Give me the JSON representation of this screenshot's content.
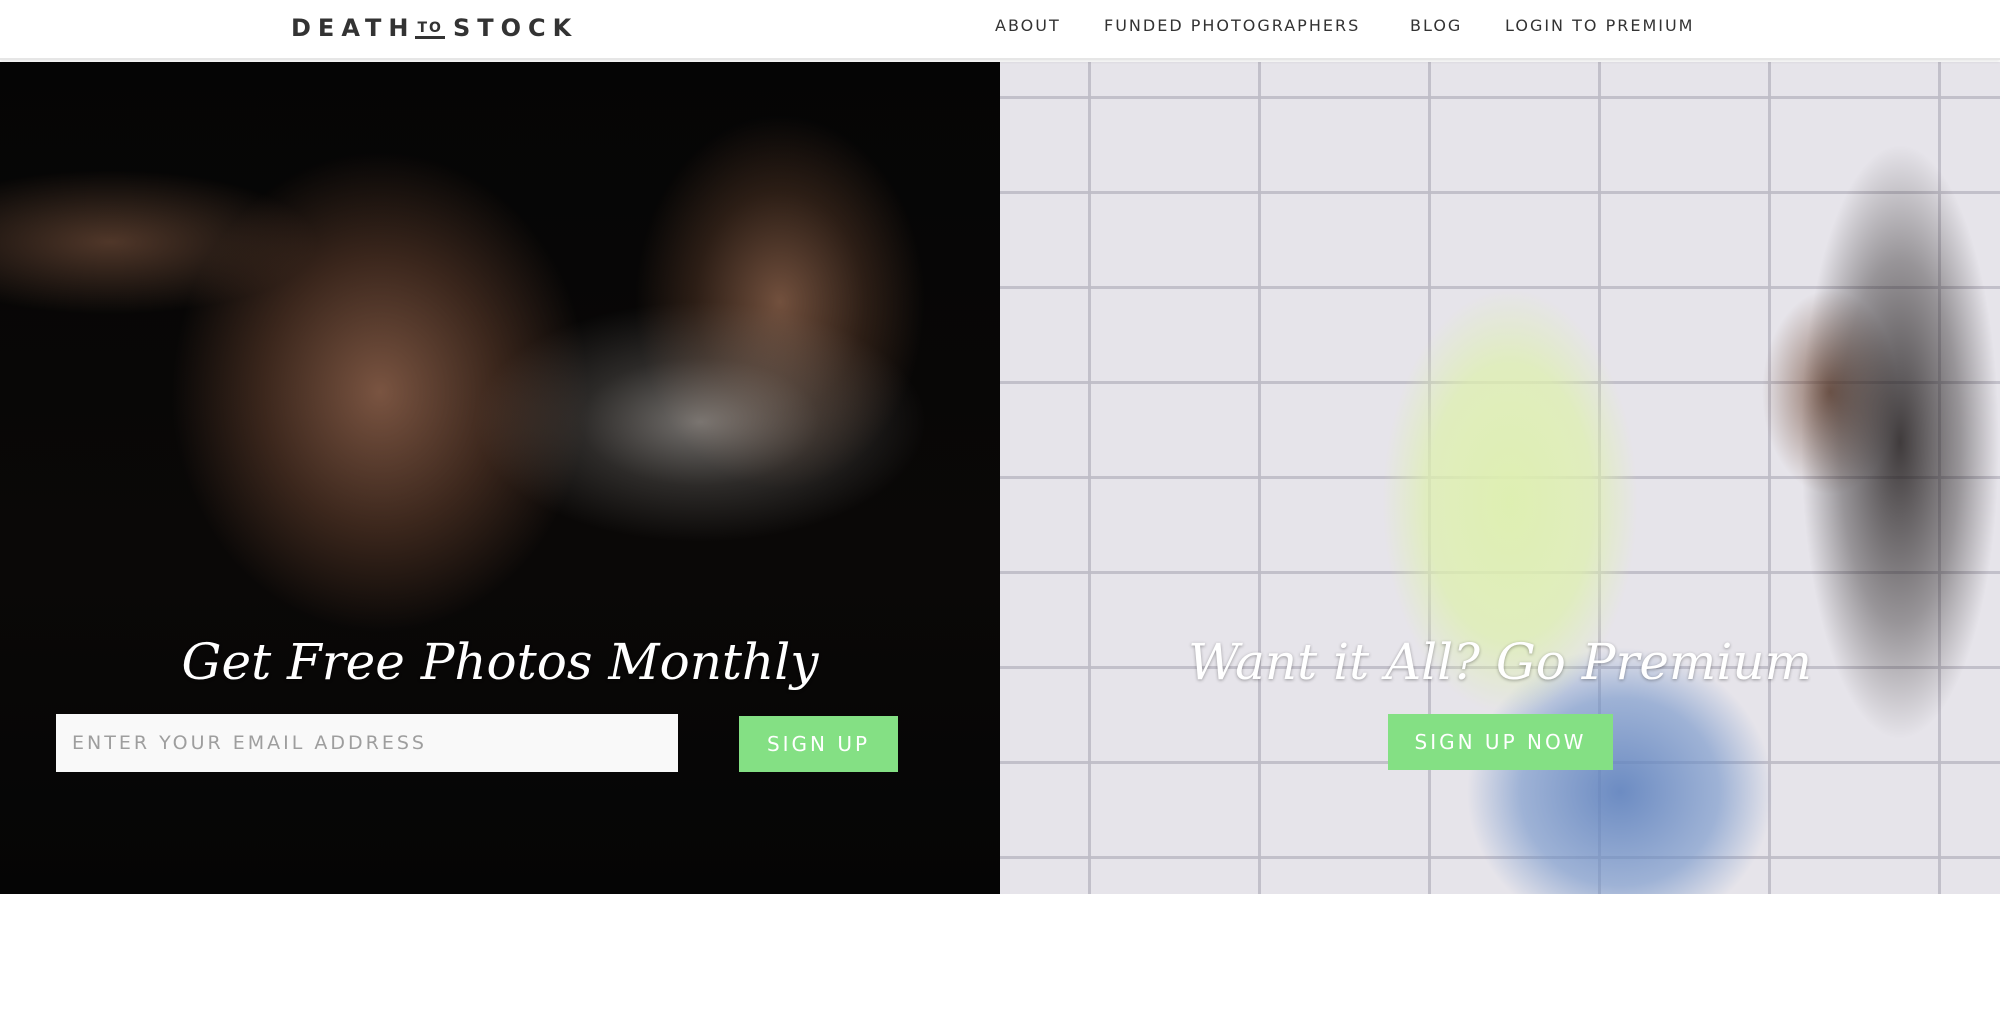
{
  "header": {
    "logo": {
      "part1": "DEATH",
      "part2": "TO",
      "part3": "STOCK"
    },
    "nav": [
      "ABOUT",
      "FUNDED PHOTOGRAPHERS",
      "BLOG",
      "LOGIN TO PREMIUM"
    ]
  },
  "hero_left": {
    "title": "Get Free Photos Monthly",
    "email_placeholder": "ENTER YOUR EMAIL ADDRESS",
    "button_label": "SIGN UP"
  },
  "hero_right": {
    "title": "Want it All? Go Premium",
    "button_label": "SIGN UP NOW"
  },
  "colors": {
    "accent_green": "#84e084",
    "text_dark": "#333333"
  }
}
